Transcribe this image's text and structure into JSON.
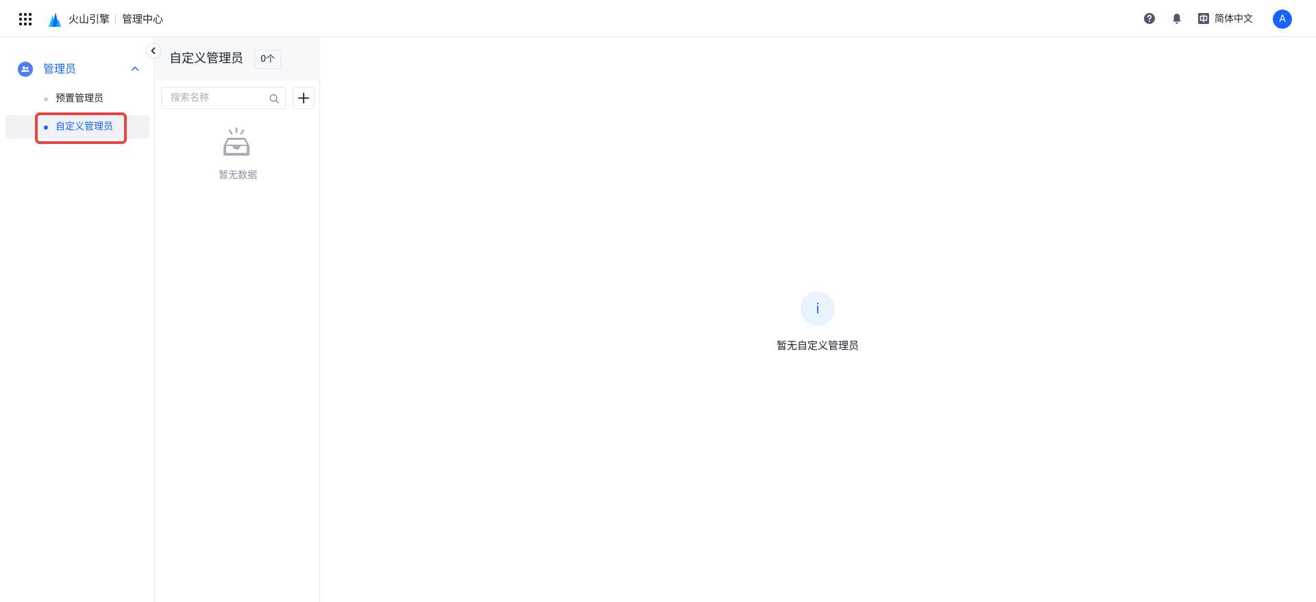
{
  "header": {
    "apps_icon": "grid-icon",
    "brand": "火山引擎",
    "product": "管理中心",
    "help_icon": "question-circle-icon",
    "bell_icon": "bell-icon",
    "language": "简体中文",
    "language_icon": "chinese-char-icon",
    "avatar_initial": "A"
  },
  "sidebar": {
    "group_label": "管理员",
    "group_icon": "users-icon",
    "items": [
      {
        "label": "预置管理员",
        "active": false
      },
      {
        "label": "自定义管理员",
        "active": true
      }
    ]
  },
  "list_panel": {
    "title": "自定义管理员",
    "count": "0个",
    "search_placeholder": "搜索名称",
    "search_value": "",
    "empty_text": "暂无数据"
  },
  "main": {
    "info_glyph": "i",
    "empty_text": "暂无自定义管理员"
  },
  "colors": {
    "accent": "#1664ff",
    "highlight": "#e8453c"
  }
}
